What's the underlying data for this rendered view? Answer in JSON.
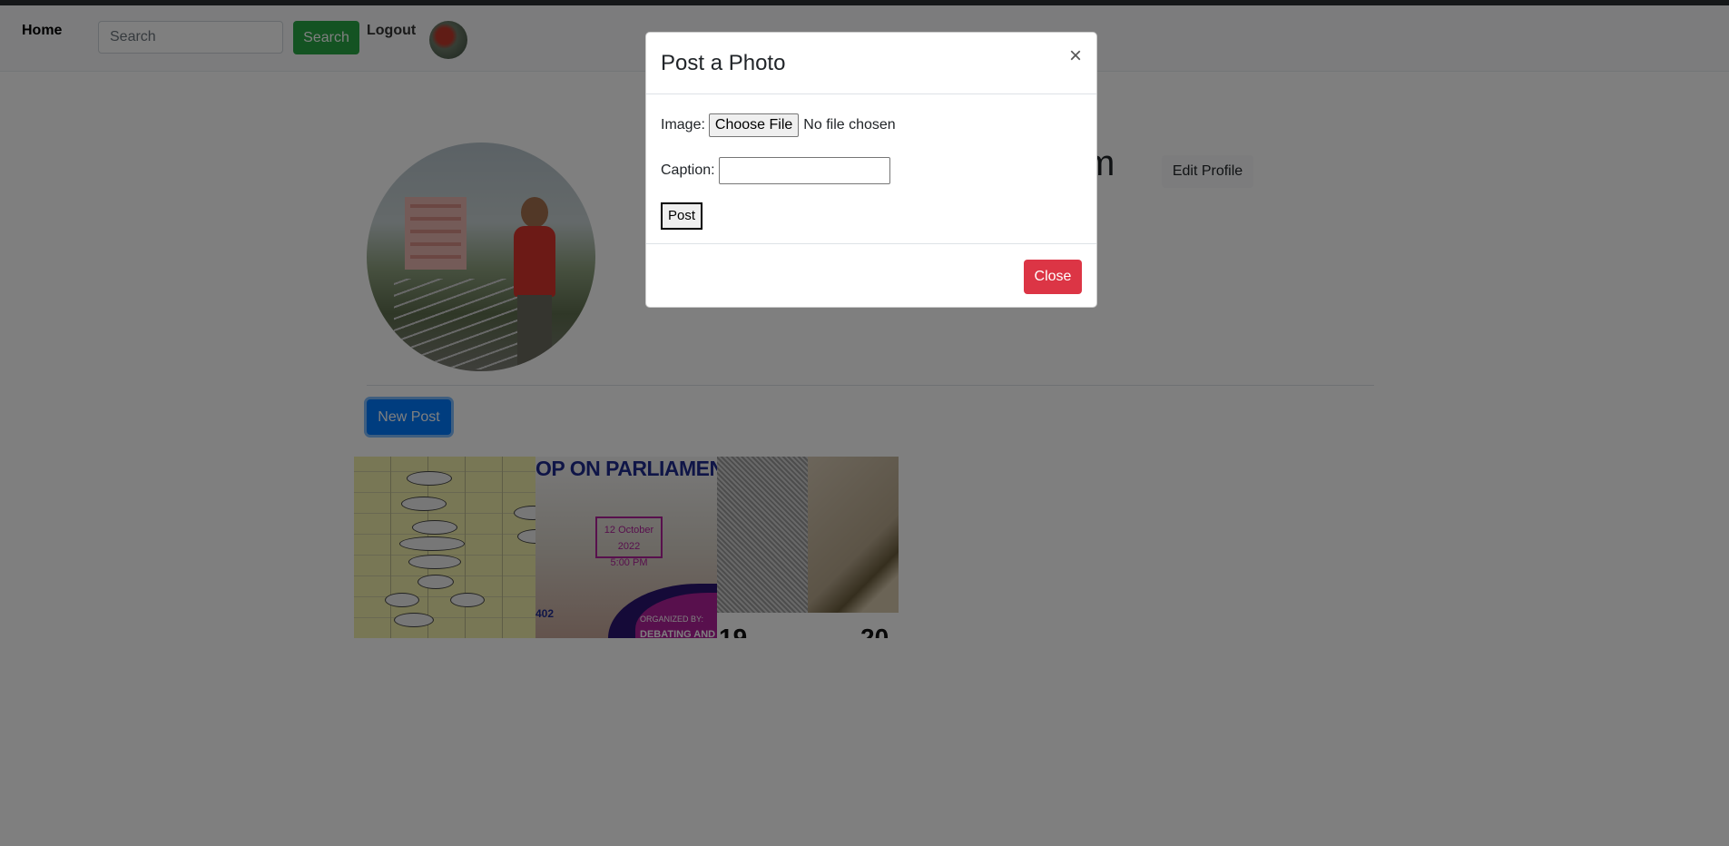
{
  "navbar": {
    "home": "Home",
    "search_placeholder": "Search",
    "search_button": "Search",
    "logout": "Logout"
  },
  "profile": {
    "username_visible_suffix": "m",
    "edit_profile": "Edit Profile",
    "new_post": "New Post"
  },
  "posts": {
    "tile2": {
      "banner": "OP ON PARLIAMENTAR",
      "date_line1": "12 October 2022",
      "date_line2": "5:00 PM",
      "room": "402",
      "organized_by": "ORGANIZED BY:",
      "organizer": "DEBATING AND PU"
    },
    "tile3": {
      "num1": "19",
      "num2": "20"
    }
  },
  "modal": {
    "title": "Post a Photo",
    "close_x": "×",
    "image_label": "Image:",
    "choose_file": "Choose File",
    "file_status": "No file chosen",
    "caption_label": "Caption:",
    "post_button": "Post",
    "close_button": "Close"
  },
  "colors": {
    "search_button": "#28a745",
    "new_post_button": "#007bff",
    "close_button": "#dc3545"
  }
}
